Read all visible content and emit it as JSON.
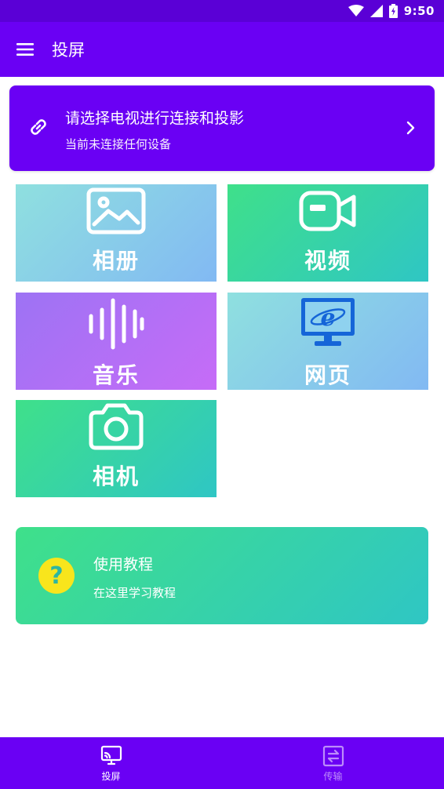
{
  "status_bar": {
    "time": "9:50",
    "icons": [
      "wifi-icon",
      "signal-icon",
      "battery-icon"
    ]
  },
  "app_bar": {
    "title": "投屏",
    "menu_icon": "menu-icon"
  },
  "connect_card": {
    "icon": "link-icon",
    "title": "请选择电视进行连接和投影",
    "subtitle": "当前未连接任何设备",
    "chevron": "chevron-right-icon"
  },
  "tiles": [
    {
      "label": "相册",
      "icon": "image-icon"
    },
    {
      "label": "视频",
      "icon": "video-camera-icon"
    },
    {
      "label": "音乐",
      "icon": "sound-wave-icon"
    },
    {
      "label": "网页",
      "icon": "browser-icon"
    },
    {
      "label": "相机",
      "icon": "camera-icon"
    }
  ],
  "tutorial": {
    "icon": "help-icon",
    "title": "使用教程",
    "subtitle": "在这里学习教程"
  },
  "bottom_nav": [
    {
      "label": "投屏",
      "icon": "screen-cast-icon",
      "active": true
    },
    {
      "label": "传输",
      "icon": "transfer-icon",
      "active": false
    }
  ],
  "colors": {
    "primary": "#6a00f4",
    "status_bar": "#5a00d6",
    "help_yellow": "#f8e51c",
    "browser_blue": "#1565d8"
  }
}
